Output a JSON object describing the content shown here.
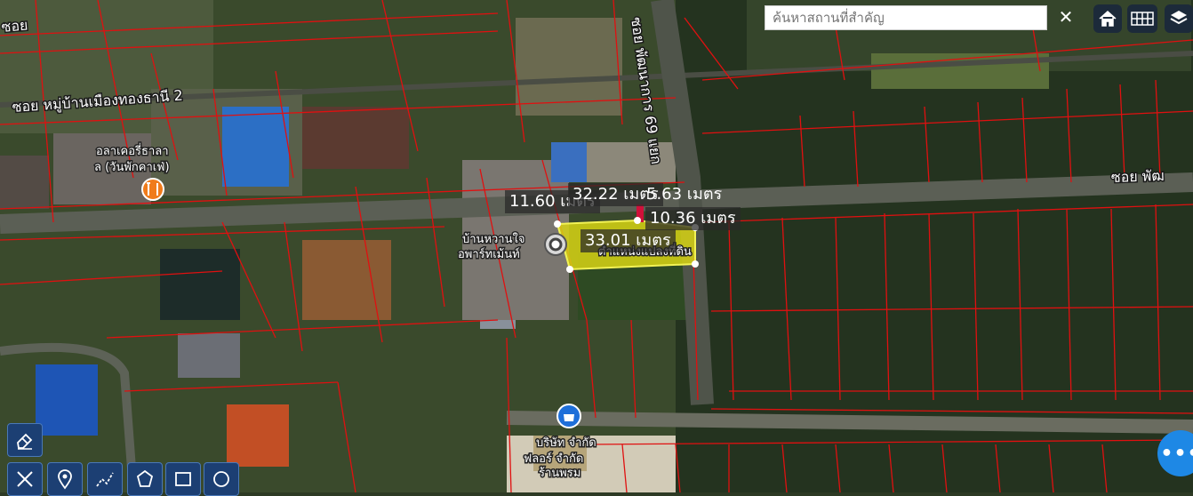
{
  "search": {
    "placeholder": "ค้นหาสถานที่สำคัญ"
  },
  "roads": {
    "road_1": "ซอย",
    "road_2": "ซอย หมู่บ้านเมืองทองธานี 2",
    "road_3": "ซอย พัฒนาการ 69 แยก",
    "road_4": "ซอย พัฒ"
  },
  "pois": {
    "restaurant_line1": "อลาเคอรี่ธาลา",
    "restaurant_line2": "ล (วันพักคาเฟ่)",
    "apartment_line1": "บ้านหวานใจ",
    "apartment_line2": "อพาร์ทเม้นท์",
    "plot_line": "ตำแหน่งแปลงที่ดิน",
    "company_line1": "บริษัท จำกัด",
    "company_line2": "ฟลอร์ จำกัด",
    "company_line3": "ร้านพรม"
  },
  "measurements": {
    "m1": "11.60 เมตร",
    "m2": "32.22 เมตร",
    "m3": "5.63 เมตร",
    "m4": "10.36 เมตร",
    "m5": "33.01 เมตร"
  },
  "fab": {
    "label": "•••"
  },
  "colors": {
    "parcel_line": "#e01010",
    "plot_fill": "#d7d414",
    "tool_bg": "#1c3f73",
    "fab": "#1e88e5"
  }
}
